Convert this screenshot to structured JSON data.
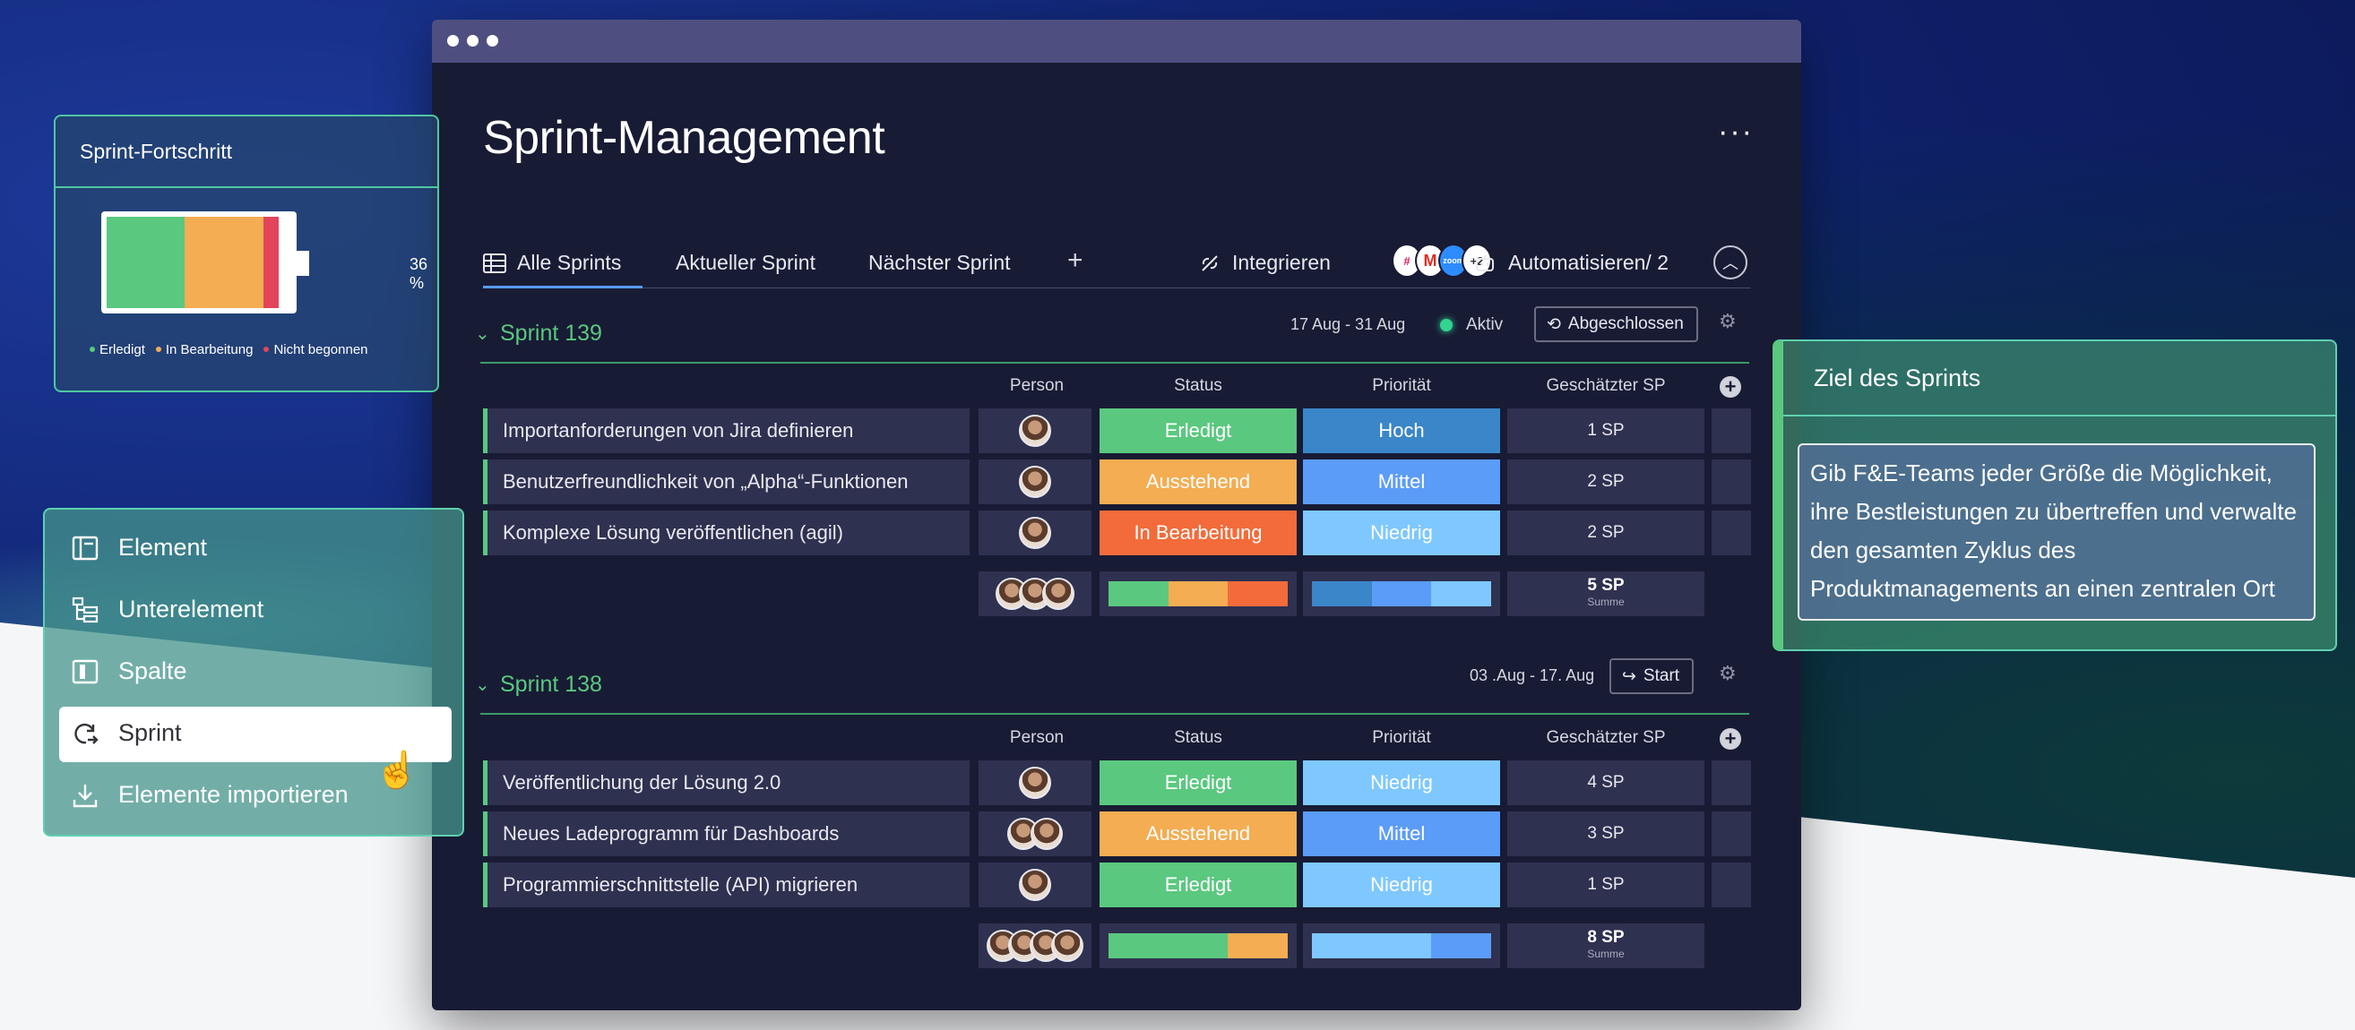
{
  "app": {
    "title": "Sprint-Management",
    "more": "···"
  },
  "tabs": [
    {
      "label": "Alle Sprints",
      "active": true
    },
    {
      "label": "Aktueller Sprint"
    },
    {
      "label": "Nächster Sprint"
    }
  ],
  "tab_add": "+",
  "integrate": {
    "label": "Integrieren",
    "extra_badge": "+2"
  },
  "automate": {
    "label": "Automatisieren/ 2"
  },
  "columns": {
    "person": "Person",
    "status": "Status",
    "priority": "Priorität",
    "sp": "Geschätzter SP"
  },
  "groups": [
    {
      "title": "Sprint 139",
      "dates": "17 Aug - 31 Aug",
      "state": "Aktiv",
      "button": "Abgeschlossen",
      "rows": [
        {
          "name": "Importanforderungen von Jira definieren",
          "status": "Erledigt",
          "priority": "Hoch",
          "sp": "1 SP"
        },
        {
          "name": "Benutzerfreundlichkeit von „Alpha“-Funktionen",
          "status": "Ausstehend",
          "priority": "Mittel",
          "sp": "2 SP"
        },
        {
          "name": "Komplexe Lösung veröffentlichen (agil)",
          "status": "In Bearbeitung",
          "priority": "Niedrig",
          "sp": "2 SP"
        }
      ],
      "sum": {
        "value": "5 SP",
        "label": "Summe"
      }
    },
    {
      "title": "Sprint 138",
      "dates": "03 .Aug - 17. Aug",
      "button": "Start",
      "rows": [
        {
          "name": "Veröffentlichung der Lösung 2.0",
          "status": "Erledigt",
          "priority": "Niedrig",
          "sp": "4 SP"
        },
        {
          "name": "Neues Ladeprogramm für Dashboards",
          "status": "Ausstehend",
          "priority": "Mittel",
          "sp": "3 SP"
        },
        {
          "name": "Programmierschnittstelle (API) migrieren",
          "status": "Erledigt",
          "priority": "Niedrig",
          "sp": "1 SP"
        }
      ],
      "sum": {
        "value": "8 SP",
        "label": "Summe"
      }
    }
  ],
  "colors": {
    "erledigt": "#5ac87f",
    "ausstehend": "#f4ad52",
    "in_bearbeitung": "#f36b3a",
    "hoch": "#3a86c8",
    "mittel": "#5b9cf8",
    "niedrig": "#7ec8ff",
    "nicht_begonnen": "#e2445c"
  },
  "progress_card": {
    "title": "Sprint-Fortschritt",
    "percent_label": "36 %",
    "shares": {
      "erledigt": 0.42,
      "in_bearbeitung": 0.43,
      "nicht_begonnen": 0.08
    },
    "legend": [
      "Erledigt",
      "In Bearbeitung",
      "Nicht begonnen"
    ]
  },
  "add_menu": {
    "items": [
      {
        "label": "Element",
        "icon": "element-icon"
      },
      {
        "label": "Unterelement",
        "icon": "subitem-icon"
      },
      {
        "label": "Spalte",
        "icon": "column-icon"
      },
      {
        "label": "Sprint",
        "icon": "sprint-icon",
        "selected": true
      },
      {
        "label": "Elemente importieren",
        "icon": "import-icon"
      }
    ]
  },
  "goal_card": {
    "title": "Ziel des Sprints",
    "text": "Gib F&E-Teams jeder Größe die Möglichkeit, ihre Bestleistungen zu übertreffen und verwalte  den gesamten Zyklus des Produktmanagements an einen zentralen Ort"
  }
}
